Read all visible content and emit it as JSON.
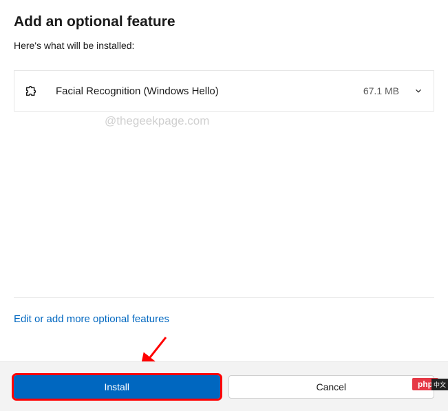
{
  "header": {
    "title": "Add an optional feature",
    "subtitle": "Here's what will be installed:"
  },
  "features": [
    {
      "name": "Facial Recognition (Windows Hello)",
      "size": "67.1 MB"
    }
  ],
  "watermark": "@thegeekpage.com",
  "link": {
    "edit_label": "Edit or add more optional features"
  },
  "buttons": {
    "install_label": "Install",
    "cancel_label": "Cancel"
  },
  "badge": {
    "php": "php",
    "cn": "中文"
  }
}
